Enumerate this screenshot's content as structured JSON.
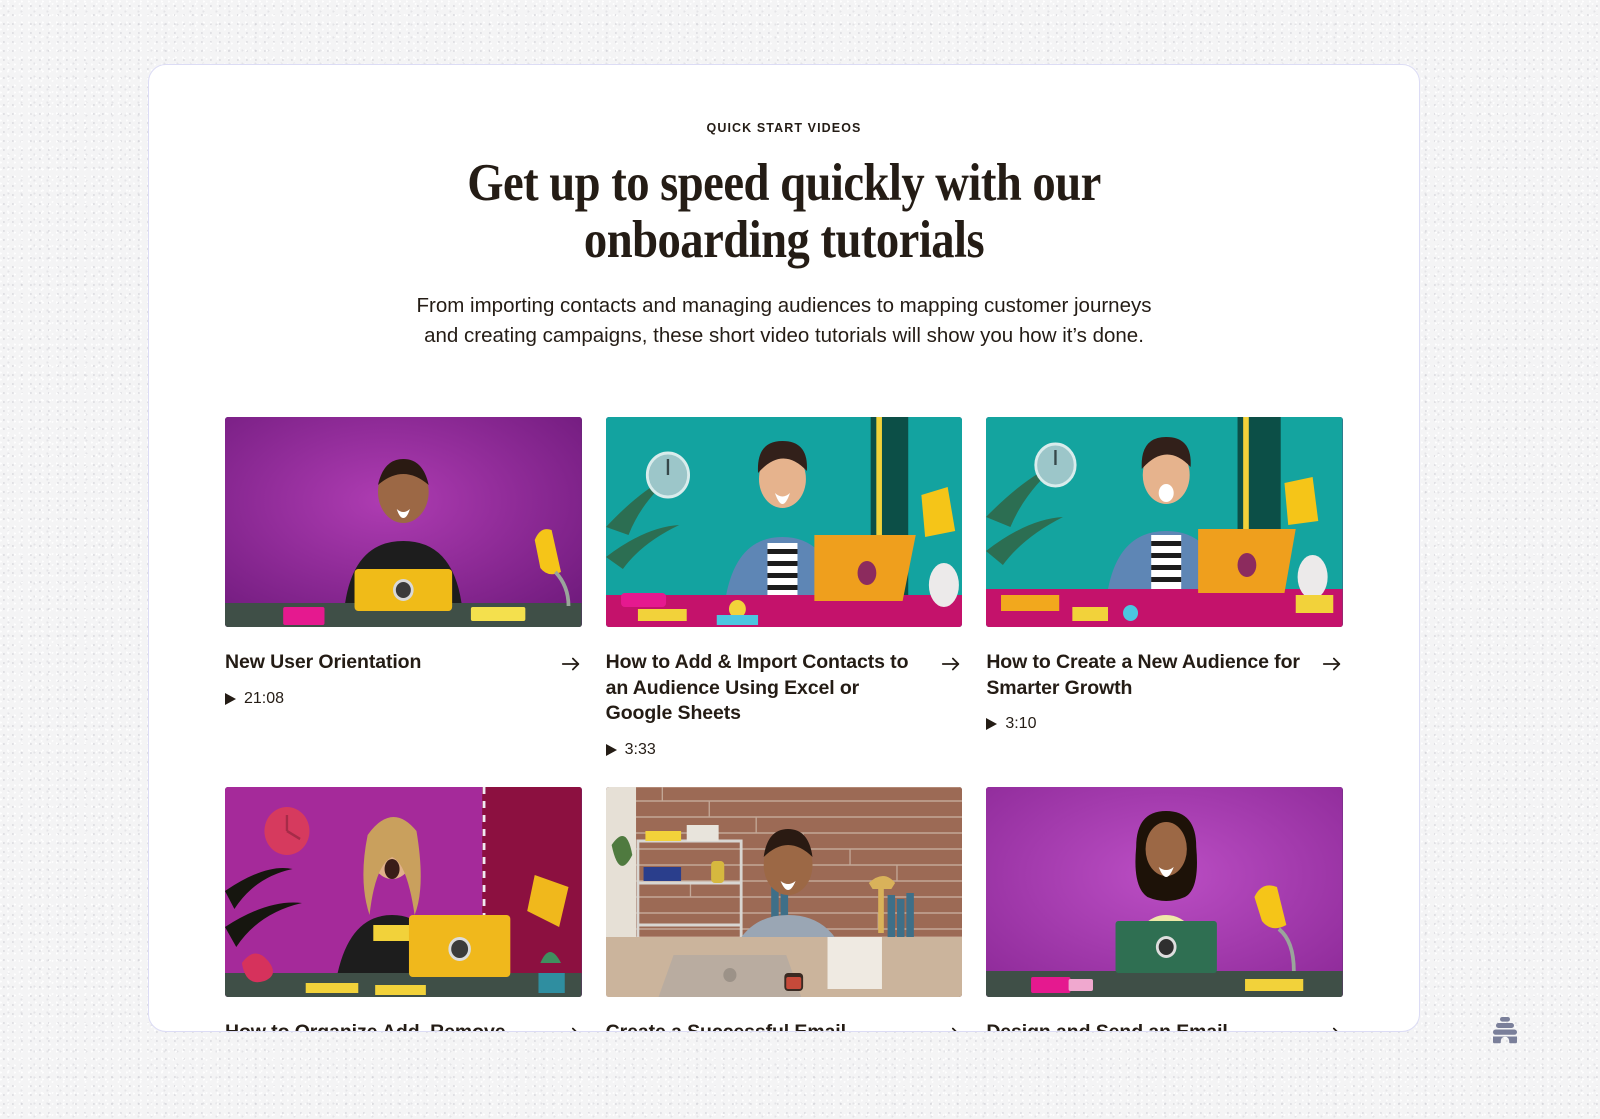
{
  "header": {
    "eyebrow": "QUICK START VIDEOS",
    "headline_line1": "Get up to speed quickly with our",
    "headline_line2": "onboarding tutorials",
    "subhead": "From importing contacts and managing audiences to mapping customer journeys and creating campaigns, these short video tutorials will show you how it’s done."
  },
  "colors": {
    "page_background": "#f4f4f5",
    "surface": "#ffffff",
    "surface_border": "#dcdcf5",
    "text": "#241c15",
    "helper_icon": "#7a7f9a"
  },
  "helper": {
    "icon": "beehive-icon",
    "label": "Help"
  },
  "videos": [
    {
      "title": "New User Orientation",
      "duration": "21:08",
      "arrow_icon": "arrow-right-icon",
      "play_icon": "play-icon",
      "thumb": {
        "scene": "purple-studio-man-laptop",
        "bg": "#9b2ea0",
        "bg2": "#7c1f86",
        "desk": "#3f4f47",
        "skin": "#9c6845",
        "shirt": "#1d1d1d",
        "laptop": "#f0bb18",
        "lamp": "#f5c518",
        "accent": "#e5198f"
      }
    },
    {
      "title": "How to Add & Import Contacts to an Audience Using Excel or Google Sheets",
      "duration": "3:33",
      "arrow_icon": "arrow-right-icon",
      "play_icon": "play-icon",
      "thumb": {
        "scene": "teal-studio-woman-laptop",
        "bg": "#13a3a0",
        "bg2": "#0f8c8a",
        "desk": "#c4126b",
        "skin": "#e6b38d",
        "shirt": "#5e86b5",
        "laptop": "#ef9f1d",
        "lamp": "#f5c518",
        "accent": "#0c4f47"
      }
    },
    {
      "title": "How to Create a New Audience for Smarter Growth",
      "duration": "3:10",
      "arrow_icon": "arrow-right-icon",
      "play_icon": "play-icon",
      "thumb": {
        "scene": "teal-studio-woman-laptop-2",
        "bg": "#14a49f",
        "bg2": "#0f8c8a",
        "desk": "#c4126b",
        "skin": "#e6b38d",
        "shirt": "#5e86b5",
        "laptop": "#ef9f1d",
        "lamp": "#f5c518",
        "accent": "#0c4f47"
      }
    },
    {
      "title": "How to Organize Add, Remove, and",
      "duration": "",
      "arrow_icon": "arrow-right-icon",
      "play_icon": "play-icon",
      "thumb": {
        "scene": "magenta-studio-person-laptop",
        "bg": "#a52a9a",
        "bg2": "#8c1f84",
        "desk": "#3f4f47",
        "skin": "#e0b08a",
        "shirt": "#1d1d1d",
        "laptop": "#f0b81c",
        "lamp": "#f0b81c",
        "accent": "#8c1040"
      }
    },
    {
      "title": "Create a Successful Email Campaign:",
      "duration": "",
      "arrow_icon": "arrow-right-icon",
      "play_icon": "play-icon",
      "thumb": {
        "scene": "brick-office-man-macbook",
        "bg": "#9a6a57",
        "bg2": "#8a5c4a",
        "desk": "#cbb49c",
        "skin": "#9c6845",
        "shirt": "#9aa6b4",
        "laptop": "#b9aca0",
        "lamp": "#d9b25a",
        "accent": "#ffffff"
      }
    },
    {
      "title": "Design and Send an Email Campaign",
      "duration": "",
      "arrow_icon": "arrow-right-icon",
      "play_icon": "play-icon",
      "thumb": {
        "scene": "purple-studio-woman-laptop",
        "bg": "#a939b4",
        "bg2": "#8e2a99",
        "desk": "#3f4f47",
        "skin": "#9c6845",
        "shirt": "#efe9a8",
        "laptop": "#2f6f52",
        "lamp": "#f5c518",
        "accent": "#e5198f"
      }
    }
  ]
}
